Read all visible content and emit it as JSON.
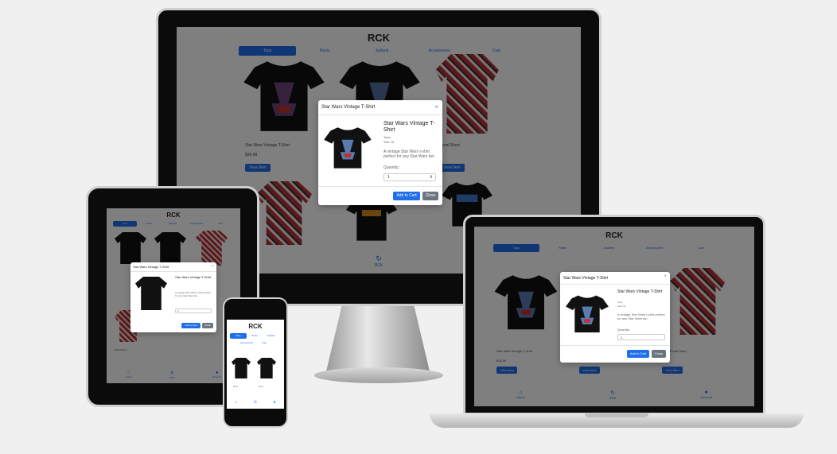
{
  "app": {
    "title": "RCK",
    "tabs": [
      "Tops",
      "Pants",
      "Jackets",
      "Accessories",
      "Cart"
    ],
    "active_tab": "Tops",
    "bottom_nav": [
      "Home",
      "RCK",
      "Account"
    ]
  },
  "products": [
    {
      "name": "Star Wars Vintage T-Shirt",
      "price": "$34.99",
      "view_label": "View Item"
    },
    {
      "name": "Star Wars Vintage T-Shirt",
      "price": "$34.99",
      "view_label": "View Item"
    },
    {
      "name": "Floral Short",
      "price": "$24.99",
      "view_label": "View Item"
    }
  ],
  "modal": {
    "title": "Star Wars Vintage T-Shirt",
    "close": "×",
    "product_name": "Star Wars Vintage T-Shirt",
    "category": "Tops",
    "size": "Size: M",
    "description": "A vintage Star Wars t-shirt perfect for any Star Wars fan",
    "quantity_label": "Quantity:",
    "quantity_value": "1",
    "add_to_cart": "Add to Cart",
    "close_button": "Close"
  },
  "colors": {
    "accent": "#1f6feb",
    "close_button": "#6c757d",
    "shirt": "#111111",
    "floral": "#b8323a"
  }
}
